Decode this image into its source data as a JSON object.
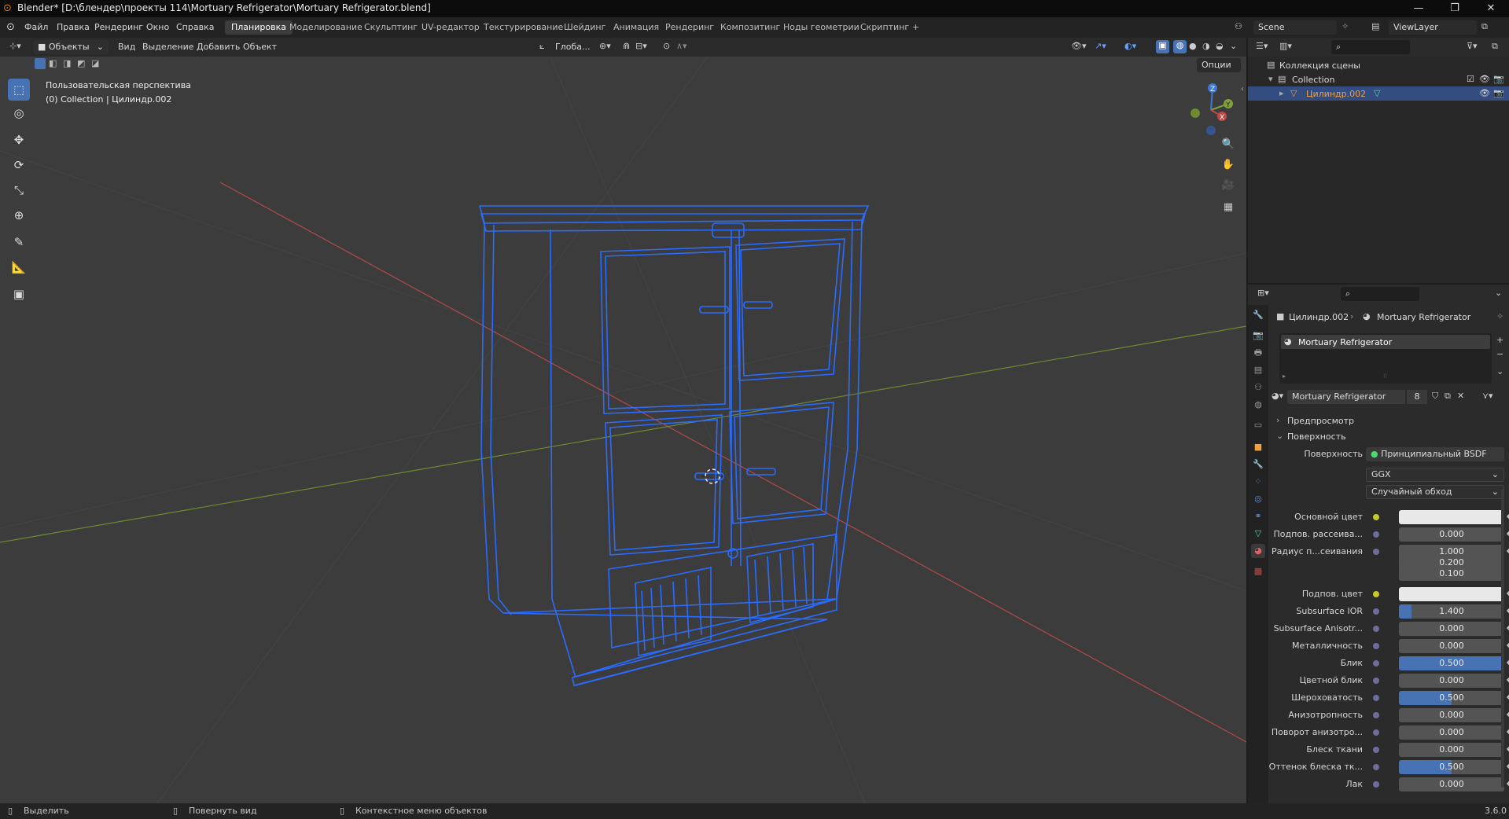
{
  "window": {
    "title": "Blender* [D:\\блендер\\проекты 114\\Mortuary Refrigerator\\Mortuary Refrigerator.blend]",
    "minimize": "—",
    "restore": "❐",
    "close": "✕"
  },
  "menu": {
    "items": [
      "Файл",
      "Правка",
      "Рендеринг",
      "Окно",
      "Справка"
    ],
    "workspaces": [
      "Планировка",
      "Моделирование",
      "Скульптинг",
      "UV-редактор",
      "Текстурирование",
      "Шейдинг",
      "Анимация",
      "Рендеринг",
      "Композитинг",
      "Ноды геометрии",
      "Скриптинг",
      "+"
    ],
    "active_workspace": "Планировка",
    "scene": "Scene",
    "view_layer": "ViewLayer"
  },
  "viewport_header": {
    "mode": "Объекты",
    "menus": [
      "Вид",
      "Выделение",
      "Добавить",
      "Объект"
    ],
    "transform_orientation": "Глоба...",
    "options": "Опции"
  },
  "viewport": {
    "view_name": "Пользовательская перспектива",
    "collection_info": "(0) Collection | Цилиндр.002",
    "gizmo_axes": [
      "Z",
      "Y",
      "X"
    ]
  },
  "outliner": {
    "scene_collection": "Коллекция сцены",
    "collection": "Collection",
    "object": "Цилиндр.002"
  },
  "properties": {
    "breadcrumb_object": "Цилиндр.002",
    "breadcrumb_material": "Mortuary Refrigerator",
    "material_slot": "Mortuary Refrigerator",
    "material_name": "Mortuary Refrigerator",
    "material_users": "8",
    "preview_label": "Предпросмотр",
    "surface_panel": "Поверхность",
    "surface_label": "Поверхность",
    "surface_shader": "Принципиальный BSDF",
    "distribution": "GGX",
    "subsurface_method": "Случайный обход",
    "rows": [
      {
        "label": "Основной цвет",
        "value": "",
        "type": "color",
        "dot": "y",
        "fill": 0
      },
      {
        "label": "Подпов. рассеива...",
        "value": "0.000",
        "type": "num",
        "dot": "b",
        "fill": 0
      },
      {
        "label": "Радиус п...сеивания",
        "value": "1.000",
        "type": "num",
        "dot": "b",
        "fill": 0
      },
      {
        "label": "",
        "value": "0.200",
        "type": "num",
        "dot": "",
        "fill": 0
      },
      {
        "label": "",
        "value": "0.100",
        "type": "num",
        "dot": "",
        "fill": 0
      },
      {
        "label": "Подпов. цвет",
        "value": "",
        "type": "color",
        "dot": "y",
        "fill": 0
      },
      {
        "label": "Subsurface IOR",
        "value": "1.400",
        "type": "num",
        "dot": "b",
        "fill": 0.12
      },
      {
        "label": "Subsurface Anisotr...",
        "value": "0.000",
        "type": "num",
        "dot": "b",
        "fill": 0
      },
      {
        "label": "Металличность",
        "value": "0.000",
        "type": "num",
        "dot": "b",
        "fill": 0
      },
      {
        "label": "Блик",
        "value": "0.500",
        "type": "num",
        "dot": "b",
        "fill": 1
      },
      {
        "label": "Цветной блик",
        "value": "0.000",
        "type": "num",
        "dot": "b",
        "fill": 0
      },
      {
        "label": "Шероховатость",
        "value": "0.500",
        "type": "num",
        "dot": "b",
        "fill": 0.5
      },
      {
        "label": "Анизотропность",
        "value": "0.000",
        "type": "num",
        "dot": "b",
        "fill": 0
      },
      {
        "label": "Поворот анизотро...",
        "value": "0.000",
        "type": "num",
        "dot": "b",
        "fill": 0
      },
      {
        "label": "Блеск ткани",
        "value": "0.000",
        "type": "num",
        "dot": "b",
        "fill": 0
      },
      {
        "label": "Оттенок блеска тк...",
        "value": "0.500",
        "type": "num",
        "dot": "b",
        "fill": 0.5
      },
      {
        "label": "Лак",
        "value": "0.000",
        "type": "num",
        "dot": "b",
        "fill": 0
      }
    ]
  },
  "statusbar": {
    "select": "Выделить",
    "rotate_view": "Повернуть вид",
    "context_menu": "Контекстное меню объектов",
    "version": "3.6.0"
  },
  "colors": {
    "accent": "#4772b3",
    "wireframe": "#2a6cff",
    "viewport_bg": "#3c3c3c",
    "x_axis": "#c04848",
    "y_axis": "#7fa03c",
    "z_axis": "#3e79d6"
  }
}
